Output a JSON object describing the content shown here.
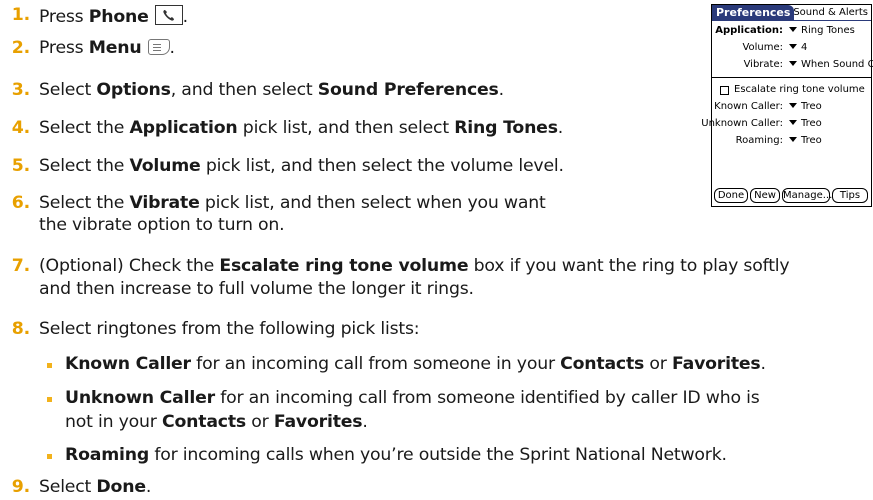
{
  "steps": [
    {
      "n": "1.",
      "parts": [
        "Press ",
        "Phone"
      ]
    },
    {
      "n": "2.",
      "parts": [
        "Press ",
        "Menu"
      ]
    },
    {
      "n": "3.",
      "parts": [
        "Select ",
        "Options",
        ", and then select ",
        "Sound Preferences",
        "."
      ]
    },
    {
      "n": "4.",
      "parts": [
        "Select the ",
        "Application",
        " pick list, and then select ",
        "Ring Tones",
        "."
      ]
    },
    {
      "n": "5.",
      "parts": [
        "Select the ",
        "Volume",
        " pick list, and then select the volume level."
      ]
    },
    {
      "n": "6.",
      "parts": [
        "Select the ",
        "Vibrate",
        " pick list, and then select when you want"
      ],
      "cont": "the vibrate option to turn on."
    },
    {
      "n": "7.",
      "parts": [
        "(Optional) Check the ",
        "Escalate ring tone volume",
        " box if you want the ring to play softly"
      ],
      "cont": "and then increase to full volume the longer it rings."
    },
    {
      "n": "8.",
      "parts": [
        "Select ringtones from the following pick lists:"
      ]
    },
    {
      "n": "9.",
      "parts": [
        "Select ",
        "Done",
        "."
      ]
    }
  ],
  "bullets": [
    {
      "parts": [
        "Known Caller",
        " for an incoming call from someone in your ",
        "Contacts",
        " or ",
        "Favorites",
        "."
      ]
    },
    {
      "parts": [
        "Unknown Caller",
        " for an incoming call from someone identified by caller ID who is"
      ],
      "cont_parts": [
        "not in your ",
        "Contacts",
        " or ",
        "Favorites",
        "."
      ]
    },
    {
      "parts": [
        "Roaming",
        " for incoming calls when you’re outside the Sprint National Network."
      ]
    }
  ],
  "palm": {
    "title": "Preferences",
    "category": "Sound & Alerts",
    "application_label": "Application:",
    "application_value": "Ring Tones",
    "volume_label": "Volume:",
    "volume_value": "4",
    "vibrate_label": "Vibrate:",
    "vibrate_value": "When Sound Off",
    "escalate_label": "Escalate ring tone volume",
    "known_label": "Known Caller:",
    "known_value": "Treo",
    "unknown_label": "Unknown Caller:",
    "unknown_value": "Treo",
    "roaming_label": "Roaming:",
    "roaming_value": "Treo",
    "buttons": [
      "Done",
      "New",
      "Manage...",
      "Tips"
    ]
  },
  "colors": {
    "step_number": "#e8a000",
    "bullet": "#f2b21c",
    "palm_header": "#2a3a7a"
  }
}
